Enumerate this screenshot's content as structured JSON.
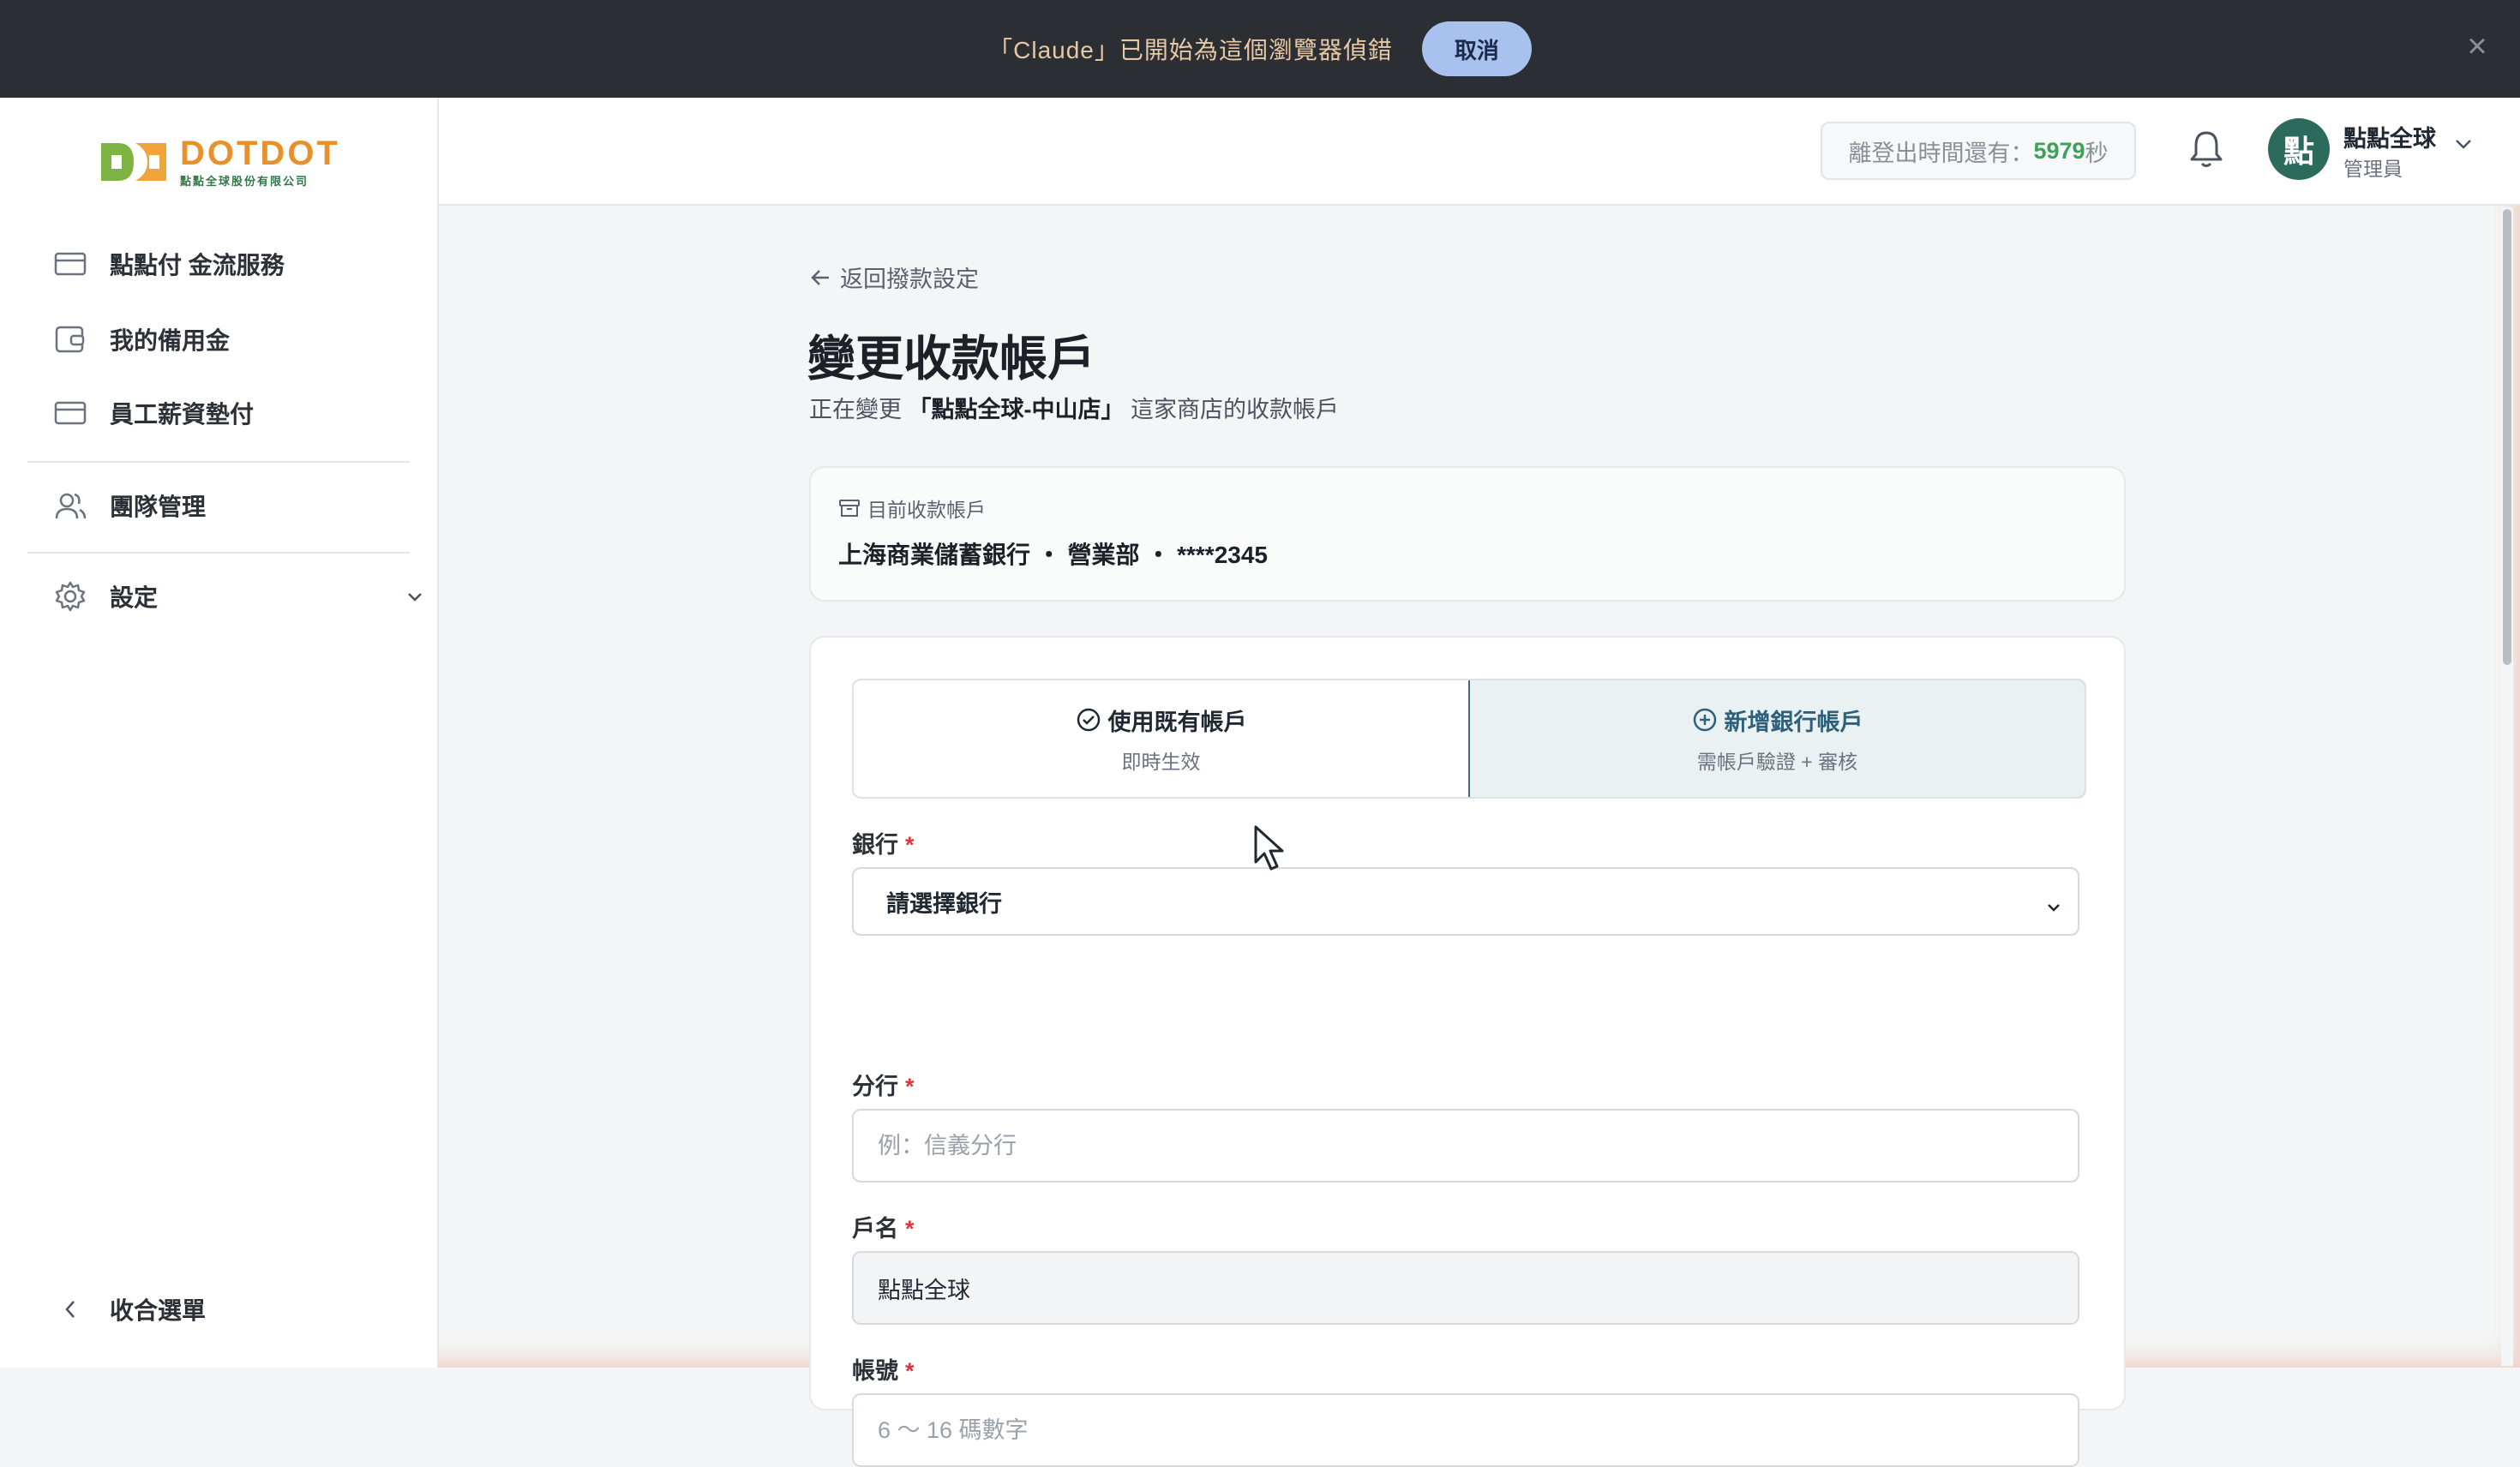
{
  "banner": {
    "message": "「Claude」已開始為這個瀏覽器偵錯",
    "cancel_label": "取消",
    "close_icon": "×"
  },
  "sidebar": {
    "logo_name": "DOTDOT",
    "logo_sub": "點點全球股份有限公司",
    "items": [
      {
        "label": "點點付 金流服務",
        "icon": "card-icon"
      },
      {
        "label": "我的備用金",
        "icon": "wallet-icon"
      },
      {
        "label": "員工薪資墊付",
        "icon": "card-icon"
      },
      {
        "label": "團隊管理",
        "icon": "users-icon"
      },
      {
        "label": "設定",
        "icon": "gear-icon"
      }
    ],
    "collapse_label": "收合選單"
  },
  "header": {
    "timer_prefix": "離登出時間還有：",
    "timer_value": "5979",
    "timer_unit": "秒",
    "avatar_char": "點",
    "user_name": "點點全球",
    "user_role": "管理員"
  },
  "page": {
    "back_label": "返回撥款設定",
    "title": "變更收款帳戶",
    "subtitle_prefix": "正在變更",
    "store_name": "「點點全球-中山店」",
    "subtitle_suffix": "這家商店的收款帳戶"
  },
  "current_account": {
    "label": "目前收款帳戶",
    "value": "上海商業儲蓄銀行 ・ 營業部 ・ ****2345"
  },
  "mode_toggle": {
    "options": [
      {
        "title": "使用既有帳戶",
        "subtitle": "即時生效",
        "selected": false
      },
      {
        "title": "新增銀行帳戶",
        "subtitle": "需帳戶驗證 + 審核",
        "selected": true
      }
    ]
  },
  "form": {
    "bank_label": "銀行",
    "bank_value": "請選擇銀行",
    "branch_label": "分行",
    "branch_placeholder": "例：信義分行",
    "holder_label": "戶名",
    "holder_value": "點點全球",
    "account_label": "帳號",
    "account_placeholder": "6 ～ 16 碼數字",
    "required_mark": "*"
  },
  "colors": {
    "accent": "#2f607a",
    "brand_orange": "#e8912b",
    "brand_green": "#7cb342",
    "avatar_bg": "#2c6b5c",
    "timer_green": "#3fa05a",
    "required_red": "#d9363e"
  }
}
